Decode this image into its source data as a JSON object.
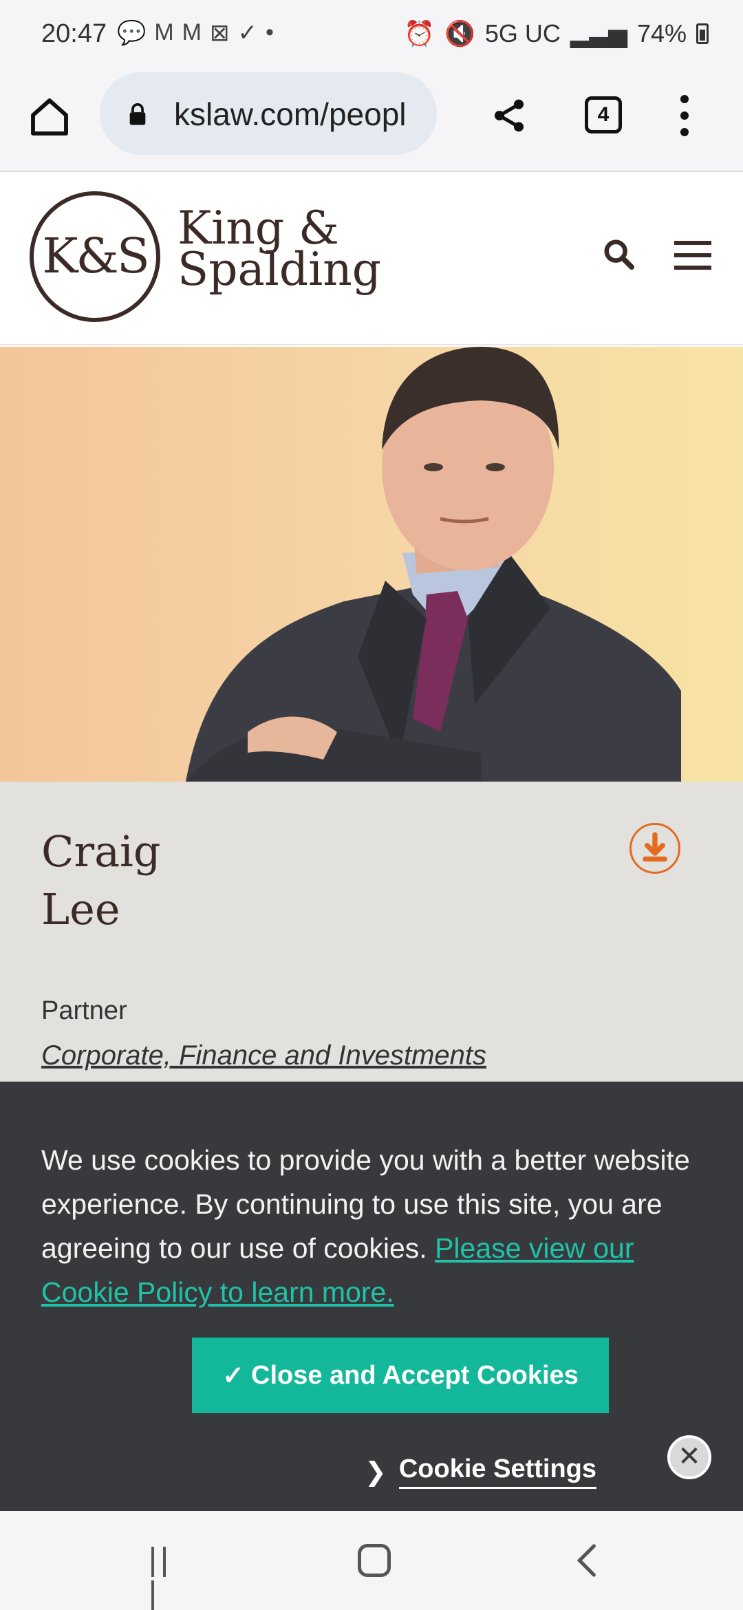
{
  "status_bar": {
    "time": "20:47",
    "left_icons": [
      "chat-icon",
      "gmail-icon",
      "gmail-icon",
      "outlook-icon",
      "check-icon",
      "dot-icon"
    ],
    "network": "5G UC",
    "battery": "74%"
  },
  "browser": {
    "url": "kslaw.com/peopl",
    "tab_count": "4"
  },
  "site": {
    "logo_mark": "K&S",
    "logo_line1": "King &",
    "logo_line2": "Spalding"
  },
  "profile": {
    "first_name": "Craig",
    "last_name": "Lee",
    "title": "Partner",
    "practice": "Corporate, Finance and Investments"
  },
  "cookie": {
    "message": "We use cookies to provide you with a better website experience. By continuing to use this site, you are agreeing to our use of cookies. ",
    "link": "Please view our Cookie Policy to learn more.",
    "accept_check": "✓",
    "accept_label": "Close and Accept Cookies",
    "settings_chevron": "❯",
    "settings_label": "Cookie Settings",
    "close_symbol": "✕"
  },
  "colors": {
    "brand": "#3b2a26",
    "accent_orange": "#e46a1e",
    "cookie_bg": "#38393c",
    "cookie_teal": "#13b79a"
  }
}
